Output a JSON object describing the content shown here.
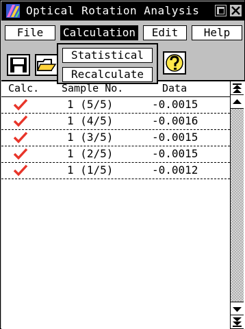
{
  "window": {
    "title": "Optical Rotation Analysis"
  },
  "menu": {
    "file": "File",
    "calculation": "Calculation",
    "edit": "Edit",
    "help": "Help"
  },
  "dropdown": {
    "items": [
      "Statistical",
      "Recalculate"
    ]
  },
  "toolbar": {
    "icons": [
      "save-icon",
      "open-folder-icon",
      "help-icon"
    ]
  },
  "table": {
    "headers": {
      "calc": "Calc.",
      "sample": "Sample No.",
      "data": "Data"
    },
    "rows": [
      {
        "checked": true,
        "sample": "1 (5/5)",
        "data": "-0.0015"
      },
      {
        "checked": true,
        "sample": "1 (4/5)",
        "data": "-0.0016"
      },
      {
        "checked": true,
        "sample": "1 (3/5)",
        "data": "-0.0015"
      },
      {
        "checked": true,
        "sample": "1 (2/5)",
        "data": "-0.0015"
      },
      {
        "checked": true,
        "sample": "1 (1/5)",
        "data": "-0.0012"
      }
    ]
  },
  "colors": {
    "check": "#e8352a",
    "titlebar": "#000000",
    "window": "#c0c0c0"
  }
}
